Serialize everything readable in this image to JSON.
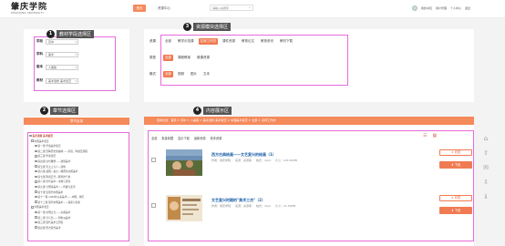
{
  "header": {
    "logo_cn": "肇庆学院",
    "logo_en": "ZHAOQING UNIVERSITY",
    "nav_home": "首页",
    "nav_resources": "资源中心",
    "search_placeholder": "请输入关键字",
    "user_links": [
      "我的书包",
      "用户管理",
      "个人中心",
      "退出"
    ]
  },
  "annotations": {
    "m1": {
      "num": "1",
      "label": "教材学段选择区"
    },
    "m2": {
      "num": "2",
      "label": "章节选择区"
    },
    "m3": {
      "num": "3",
      "label": "资源模块选择区"
    },
    "m4": {
      "num": "4",
      "label": "内容展示区"
    }
  },
  "textbook_selector": {
    "rows": [
      {
        "label": "学段",
        "value": "高中"
      },
      {
        "label": "学科",
        "value": "美术"
      },
      {
        "label": "版本",
        "value": "人美版"
      },
      {
        "label": "教材",
        "value": "美术选修 美术鉴赏"
      }
    ]
  },
  "resource_filter": {
    "rows": [
      {
        "label": "资源",
        "chips": [
          "全部",
          "教学示范课",
          "名师工作坊",
          "课件资源",
          "教育论文",
          "教育资讯",
          "教材下载"
        ],
        "active": 2
      },
      {
        "label": "类型",
        "chips": [
          "全部",
          "课程教案",
          "微课资源"
        ],
        "active": 0
      },
      {
        "label": "格式",
        "chips": [
          "全部",
          "视频",
          "图片",
          "文本"
        ],
        "active": 0
      }
    ]
  },
  "chapter": {
    "header": "章节目录",
    "items": [
      {
        "level": 0,
        "text": "美术选修 美术鉴赏"
      },
      {
        "level": 1,
        "text": "中国美术鉴赏"
      },
      {
        "level": 2,
        "text": "第一课 学会美术鉴赏"
      },
      {
        "level": 2,
        "text": "第二课 回眸历史的巅峰——宋画、陶瓷及国画"
      },
      {
        "level": 2,
        "text": "第三课 华夏意匠"
      },
      {
        "level": 2,
        "text": "第四课 古代雕塑——透视美术"
      },
      {
        "level": 2,
        "text": "第五课 天之上与人—建筑"
      },
      {
        "level": 2,
        "text": "第六课 战国—秦汉—魏晋南北朝美术"
      },
      {
        "level": 2,
        "text": "第七课 隋唐五代—辉煌的气象"
      },
      {
        "level": 2,
        "text": "第八课 宋代美术—书卷与灵性"
      },
      {
        "level": 2,
        "text": "第九课 元明清美术——传统与变革"
      },
      {
        "level": 2,
        "text": "第十课 近现代中国美术"
      },
      {
        "level": 2,
        "text": "第十一课 1949年以来美术——中国、我们"
      },
      {
        "level": 2,
        "text": "第十二课 现代中国美术——探索与创新"
      },
      {
        "level": 1,
        "text": "外国美术鉴赏"
      },
      {
        "level": 2,
        "text": "第一课 文明之光——古典美术"
      },
      {
        "level": 2,
        "text": "第二课 光与色——印象派美术"
      },
      {
        "level": 2,
        "text": "第三课 现代美术之历程"
      },
      {
        "level": 2,
        "text": "第四课 西方现代美术"
      }
    ]
  },
  "content": {
    "breadcrumb": "您的位置：首页 > 高中 > 人美版 > 美术选修 美术鉴赏 > 中国美术鉴赏 > 全部 > 名师工作坊",
    "toolbar": [
      "全选",
      "批量收藏",
      "显示下载",
      "最新资源",
      "校本资源"
    ],
    "items": [
      {
        "title": "西方古典绘画——文艺复兴的绘画（1）",
        "meta": [
          "作者：肇庆学院",
          "来源：资源库",
          "格式：mp4",
          "大小：224.62MB"
        ],
        "fav": "收藏",
        "download": "下载"
      },
      {
        "title": "文艺复兴时期的\"美术三杰\"（2）",
        "meta": [
          "作者：肇庆学院",
          "来源：资源库",
          "格式：mp4",
          "大小：21.39MB"
        ],
        "fav": "收藏",
        "download": "下载"
      }
    ]
  },
  "side_tools": [
    "home-icon",
    "up-icon",
    "message-icon",
    "download-icon",
    "down-icon"
  ]
}
